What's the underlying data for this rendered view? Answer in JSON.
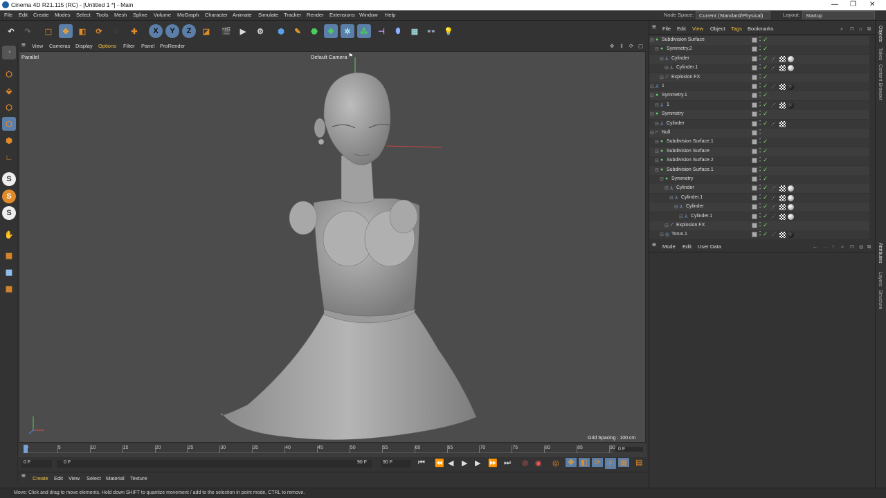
{
  "window": {
    "title": "Cinema 4D R21.115 (RC) - [Untitled 1 *] - Main"
  },
  "menu": [
    "File",
    "Edit",
    "Create",
    "Modes",
    "Select",
    "Tools",
    "Mesh",
    "Spline",
    "Volume",
    "MoGraph",
    "Character",
    "Animate",
    "Simulate",
    "Tracker",
    "Render",
    "Extensions",
    "Window",
    "Help"
  ],
  "node_space": {
    "label": "Node Space:",
    "value": "Current (Standard/Physical)"
  },
  "layout": {
    "label": "Layout:",
    "value": "Startup"
  },
  "toolbar": {
    "x": "X",
    "y": "Y",
    "z": "Z"
  },
  "viewport": {
    "menu": [
      "View",
      "Cameras",
      "Display",
      "Options",
      "Filter",
      "Panel",
      "ProRender"
    ],
    "projection": "Parallel",
    "camera": "Default Camera",
    "grid_spacing": "Grid Spacing : 100 cm"
  },
  "timeline": {
    "ticks": [
      "0",
      "5",
      "10",
      "15",
      "20",
      "25",
      "30",
      "35",
      "40",
      "45",
      "50",
      "55",
      "60",
      "65",
      "70",
      "75",
      "80",
      "85",
      "90"
    ],
    "end_frame": "0 F"
  },
  "transport": {
    "start": "0 F",
    "current": "0 F",
    "end1": "90 F",
    "end2": "90 F"
  },
  "material_menu": [
    "Create",
    "Edit",
    "View",
    "Select",
    "Material",
    "Texture"
  ],
  "status": "Move: Click and drag to move elements. Hold down SHIFT to quantize movement / add to the selection in point mode, CTRL to remove.",
  "object_menu": [
    "File",
    "Edit",
    "View",
    "Object",
    "Tags",
    "Bookmarks"
  ],
  "objects": [
    {
      "name": "Subdivision Surface",
      "indent": 0,
      "icon": "subdivision-icon",
      "check": true,
      "tags": ""
    },
    {
      "name": "Symmetry.2",
      "indent": 1,
      "icon": "symmetry-icon",
      "check": true,
      "tags": ""
    },
    {
      "name": "Cylinder",
      "indent": 2,
      "icon": "cylinder-icon",
      "check": true,
      "tags": "full"
    },
    {
      "name": "Cylinder.1",
      "indent": 3,
      "icon": "cylinder-icon",
      "check": true,
      "tags": "full"
    },
    {
      "name": "Explosion FX",
      "indent": 2,
      "icon": "explosion-icon",
      "check": true,
      "tags": ""
    },
    {
      "name": "1",
      "indent": 0,
      "icon": "cylinder-icon",
      "check": true,
      "tags": "dark"
    },
    {
      "name": "Symmetry.1",
      "indent": 0,
      "icon": "symmetry-icon",
      "check": true,
      "tags": ""
    },
    {
      "name": "1",
      "indent": 1,
      "icon": "cylinder-icon",
      "check": true,
      "tags": "dark"
    },
    {
      "name": "Symmetry",
      "indent": 0,
      "icon": "symmetry-icon",
      "check": true,
      "tags": ""
    },
    {
      "name": "Cylinder",
      "indent": 1,
      "icon": "cylinder-icon",
      "check": true,
      "tags": "half"
    },
    {
      "name": "Null",
      "indent": 0,
      "icon": "null-icon",
      "check": false,
      "tags": ""
    },
    {
      "name": "Subdivision Surface.1",
      "indent": 1,
      "icon": "subdivision-icon",
      "check": true,
      "tags": ""
    },
    {
      "name": "Subdivision Surface",
      "indent": 1,
      "icon": "subdivision-icon",
      "check": true,
      "tags": ""
    },
    {
      "name": "Subdivision Surface.2",
      "indent": 1,
      "icon": "subdivision-icon",
      "check": true,
      "tags": ""
    },
    {
      "name": "Subdivision Surface.1",
      "indent": 1,
      "icon": "subdivision-icon",
      "check": true,
      "tags": ""
    },
    {
      "name": "Symmetry",
      "indent": 2,
      "icon": "symmetry-icon",
      "check": true,
      "tags": ""
    },
    {
      "name": "Cylinder",
      "indent": 3,
      "icon": "cylinder-icon",
      "check": true,
      "tags": "full"
    },
    {
      "name": "Cylinder.1",
      "indent": 4,
      "icon": "cylinder-icon",
      "check": true,
      "tags": "full"
    },
    {
      "name": "Cylinder",
      "indent": 5,
      "icon": "cylinder-icon",
      "check": true,
      "tags": "full"
    },
    {
      "name": "Cylinder.1",
      "indent": 6,
      "icon": "cylinder-icon",
      "check": true,
      "tags": "full"
    },
    {
      "name": "Explosion FX",
      "indent": 3,
      "icon": "explosion-icon",
      "check": true,
      "tags": ""
    },
    {
      "name": "Torus.1",
      "indent": 2,
      "icon": "torus-icon",
      "check": true,
      "tags": "dark"
    }
  ],
  "attr_menu": [
    "Mode",
    "Edit",
    "User Data"
  ],
  "right_tabs": {
    "objects": "Objects",
    "takes": "Takes",
    "content_browser": "Content Browser",
    "attributes": "Attributes",
    "layers": "Layers",
    "structure": "Structure"
  },
  "colors": {
    "accent": "#5b7fa8",
    "checkmark": "#7fd66b",
    "viewport": "#4c4c4c"
  }
}
